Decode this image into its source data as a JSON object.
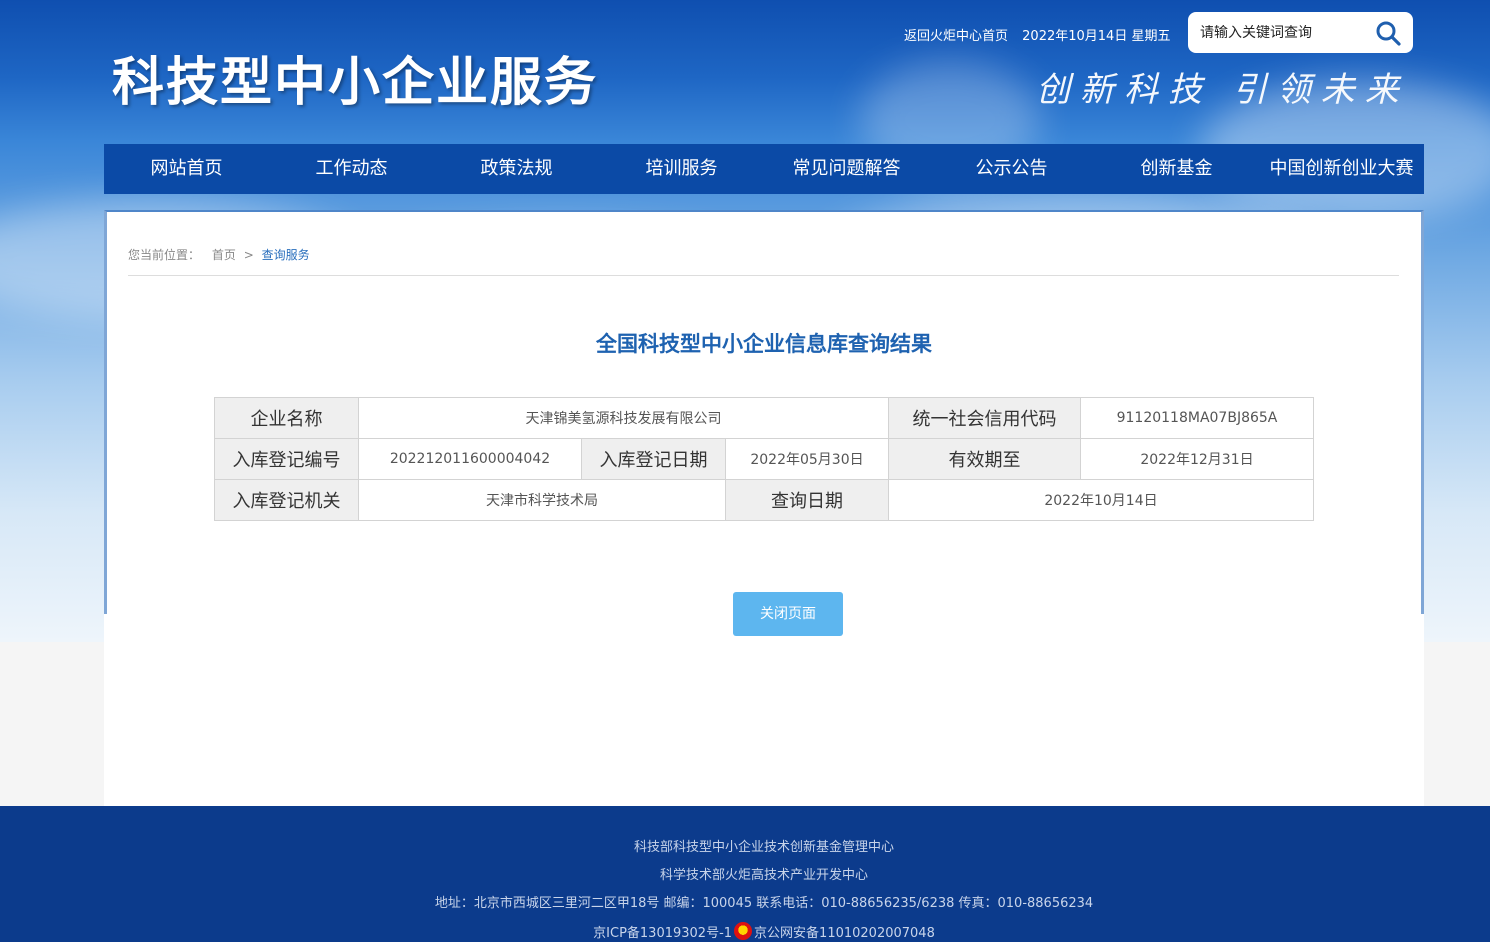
{
  "header": {
    "site_title": "科技型中小企业服务",
    "slogan": "创新科技 引领未来",
    "back_link": "返回火炬中心首页",
    "date_text": "2022年10月14日 星期五",
    "search_placeholder": "请输入关键词查询"
  },
  "nav": {
    "items": [
      "网站首页",
      "工作动态",
      "政策法规",
      "培训服务",
      "常见问题解答",
      "公示公告",
      "创新基金",
      "中国创新创业大赛"
    ]
  },
  "breadcrumb": {
    "prefix": "您当前位置：",
    "home": "首页",
    "separator": ">",
    "current": "查询服务"
  },
  "result": {
    "title": "全国科技型中小企业信息库查询结果",
    "labels": {
      "company_name": "企业名称",
      "credit_code": "统一社会信用代码",
      "reg_no": "入库登记编号",
      "reg_date": "入库登记日期",
      "valid_until": "有效期至",
      "reg_authority": "入库登记机关",
      "query_date": "查询日期"
    },
    "values": {
      "company_name": "天津锦美氢源科技发展有限公司",
      "credit_code": "91120118MA07BJ865A",
      "reg_no": "202212011600004042",
      "reg_date": "2022年05月30日",
      "valid_until": "2022年12月31日",
      "reg_authority": "天津市科学技术局",
      "query_date": "2022年10月14日"
    },
    "close_button": "关闭页面"
  },
  "footer": {
    "line1": "科技部科技型中小企业技术创新基金管理中心",
    "line2": "科学技术部火炬高技术产业开发中心",
    "line3": "地址：北京市西城区三里河二区甲18号 邮编：100045 联系电话：010-88656235/6238 传真：010-88656234",
    "icp": "京ICP备13019302号-1",
    "police": "京公网安备11010202007048"
  },
  "colors": {
    "nav_bg": "#0b4aa6",
    "title_blue": "#1e62b0",
    "button_bg": "#5db6ef",
    "footer_bg": "#0c3b8c"
  }
}
